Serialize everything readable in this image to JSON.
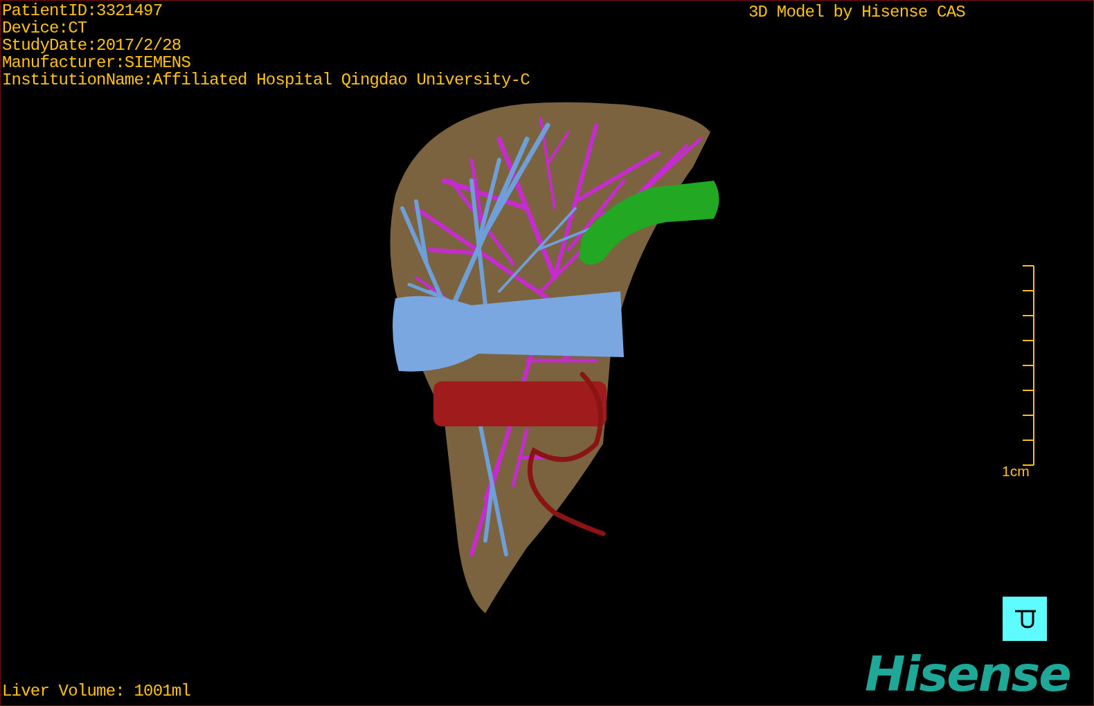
{
  "study_info": [
    "PatientID:3321497",
    "Device:CT",
    "StudyDate:2017/2/28",
    "Manufacturer:SIEMENS",
    "InstitutionName:Affiliated Hospital Qingdao University-C"
  ],
  "model_credit": "3D Model by Hisense CAS",
  "scale_bar": {
    "label": "1cm"
  },
  "liver_volume": "Liver Volume: 1001ml",
  "logo": "Hisense"
}
